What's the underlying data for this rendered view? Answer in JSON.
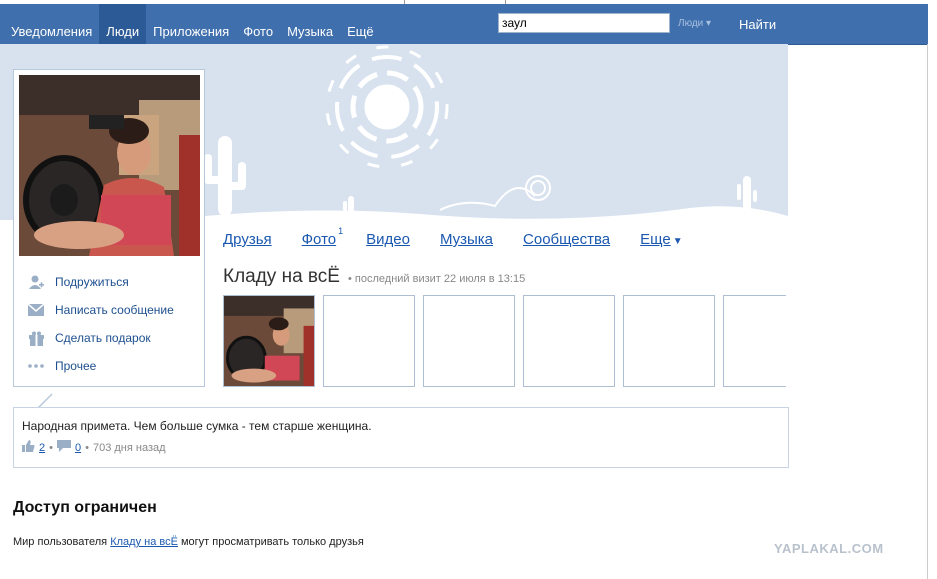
{
  "nav": {
    "items": [
      "Уведомления",
      "Люди",
      "Приложения",
      "Фото",
      "Музыка",
      "Ещё"
    ],
    "active_index": 1,
    "search_value": "заул",
    "search_scope": "Люди",
    "find_label": "Найти"
  },
  "profile": {
    "actions": [
      {
        "label": "Подружиться",
        "icon": "add-friend-icon"
      },
      {
        "label": "Написать сообщение",
        "icon": "envelope-icon"
      },
      {
        "label": "Сделать подарок",
        "icon": "gift-icon"
      },
      {
        "label": "Прочее",
        "icon": "more-dots-icon"
      }
    ],
    "tabs": {
      "friends": "Друзья",
      "photos": "Фото",
      "photos_count": "1",
      "video": "Видео",
      "music": "Музыка",
      "communities": "Сообщества",
      "more": "Еще"
    },
    "name": "Кладу на всЁ",
    "last_visit": "последний визит 22 июля в 13:15"
  },
  "status": {
    "text": "Народная примета. Чем больше сумка - тем старше женщина.",
    "likes": "2",
    "comments": "0",
    "time": "703 дня назад"
  },
  "access": {
    "title": "Доступ ограничен",
    "text_prefix": "Мир пользователя ",
    "link": "Кладу на всЁ",
    "text_suffix": " могут просматривать только друзья"
  },
  "watermark": "YAPLAKAL.COM",
  "colors": {
    "topbar": "#3f6fad",
    "banner": "#d8e2ef",
    "link": "#1a58b0"
  }
}
